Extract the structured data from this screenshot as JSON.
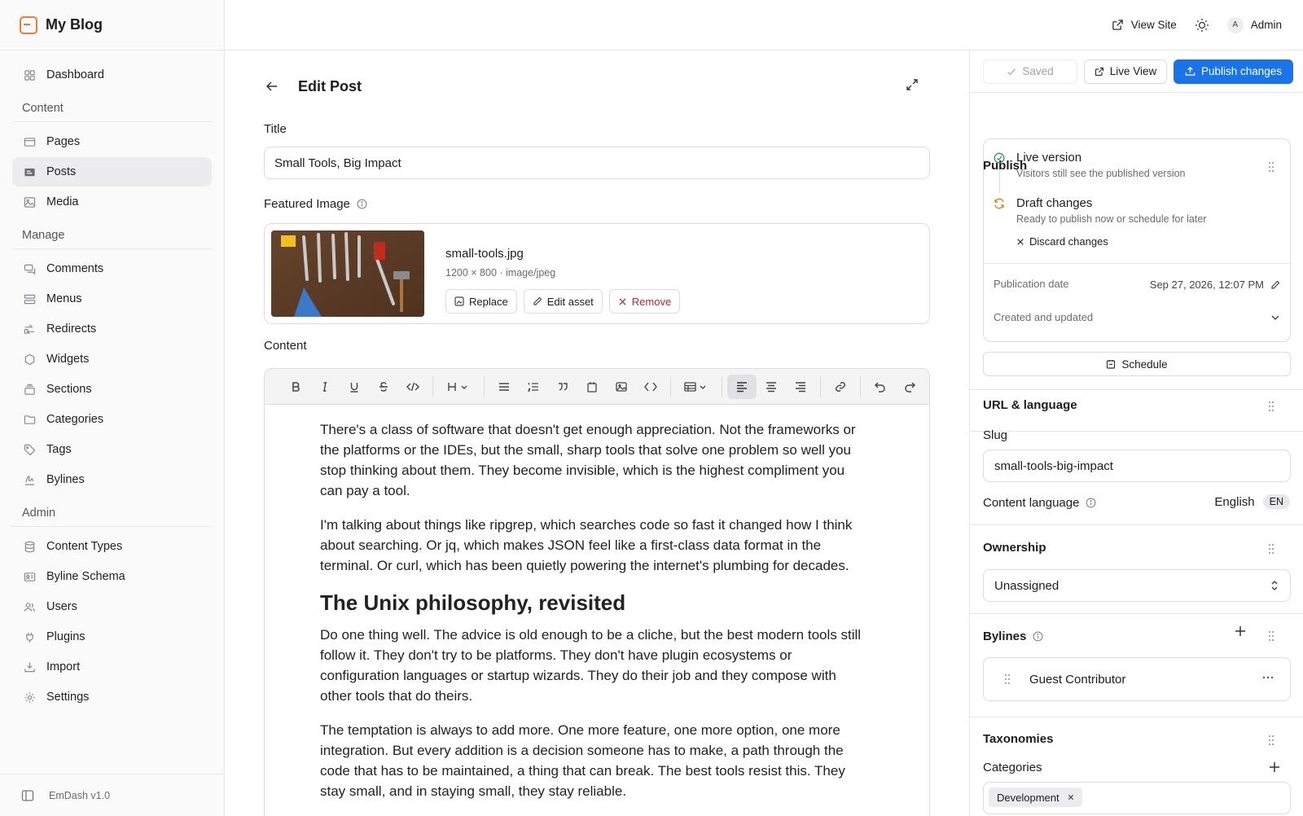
{
  "brand": {
    "name": "My Blog",
    "accent": "#f07a3a"
  },
  "sidebar": {
    "items": [
      {
        "label": "Dashboard",
        "icon": "grid-icon"
      }
    ],
    "sections": [
      {
        "title": "Content",
        "items": [
          {
            "label": "Pages",
            "icon": "page-icon"
          },
          {
            "label": "Posts",
            "icon": "posts-icon",
            "active": true
          },
          {
            "label": "Media",
            "icon": "image-icon"
          }
        ]
      },
      {
        "title": "Manage",
        "items": [
          {
            "label": "Comments",
            "icon": "comments-icon"
          },
          {
            "label": "Menus",
            "icon": "menu-icon"
          },
          {
            "label": "Redirects",
            "icon": "redirect-icon"
          },
          {
            "label": "Widgets",
            "icon": "widget-icon"
          },
          {
            "label": "Sections",
            "icon": "sections-icon"
          },
          {
            "label": "Categories",
            "icon": "folder-icon"
          },
          {
            "label": "Tags",
            "icon": "tag-icon"
          },
          {
            "label": "Bylines",
            "icon": "signature-icon"
          }
        ]
      },
      {
        "title": "Admin",
        "items": [
          {
            "label": "Content Types",
            "icon": "database-icon"
          },
          {
            "label": "Byline Schema",
            "icon": "id-card-icon"
          },
          {
            "label": "Users",
            "icon": "users-icon"
          },
          {
            "label": "Plugins",
            "icon": "plug-icon"
          },
          {
            "label": "Import",
            "icon": "import-icon"
          },
          {
            "label": "Settings",
            "icon": "gear-icon"
          }
        ]
      }
    ],
    "footer": "EmDash v1.0"
  },
  "topbar": {
    "view_site": "View Site",
    "user": "Admin",
    "avatar_initial": "A"
  },
  "editor": {
    "page_title": "Edit Post",
    "title_label": "Title",
    "title_value": "Small Tools, Big Impact",
    "featured_label": "Featured Image",
    "file_name": "small-tools.jpg",
    "file_meta": "1200 × 800 · image/jpeg",
    "replace": "Replace",
    "edit_asset": "Edit asset",
    "remove": "Remove",
    "content_label": "Content",
    "paragraphs_before": [
      "There's a class of software that doesn't get enough appreciation. Not the frameworks or the platforms or the IDEs, but the small, sharp tools that solve one problem so well you stop thinking about them. They become invisible, which is the highest compliment you can pay a tool.",
      "I'm talking about things like ripgrep, which searches code so fast it changed how I think about searching. Or jq, which makes JSON feel like a first-class data format in the terminal. Or curl, which has been quietly powering the internet's plumbing for decades."
    ],
    "heading": "The Unix philosophy, revisited",
    "paragraphs_after": [
      "Do one thing well. The advice is old enough to be a cliche, but the best modern tools still follow it. They don't try to be platforms. They don't have plugin ecosystems or configuration languages or startup wizards. They do their job and they compose with other tools that do theirs.",
      "The temptation is always to add more. One more feature, one more option, one more integration. But every addition is a decision someone has to make, a path through the code that has to be maintained, a thing that can break. The best tools resist this. They stay small, and in staying small, they stay reliable."
    ]
  },
  "panel": {
    "saved": "Saved",
    "live_view": "Live View",
    "publish": "Publish changes",
    "publish_title": "Publish",
    "live_version": "Live version",
    "live_desc": "Visitors still see the published version",
    "draft_changes": "Draft changes",
    "draft_desc": "Ready to publish now or schedule for later",
    "discard": "Discard changes",
    "pub_date_label": "Publication date",
    "pub_date": "Sep 27, 2026, 12:07 PM",
    "created_updated": "Created and updated",
    "schedule": "Schedule",
    "url_title": "URL & language",
    "slug_label": "Slug",
    "slug_value": "small-tools-big-impact",
    "lang_label": "Content language",
    "lang_value": "English",
    "lang_code": "EN",
    "ownership_title": "Ownership",
    "ownership_value": "Unassigned",
    "bylines_title": "Bylines",
    "byline_name": "Guest Contributor",
    "taxonomies_title": "Taxonomies",
    "categories_label": "Categories",
    "category_tag": "Development",
    "primary_color": "#1a73e8"
  }
}
